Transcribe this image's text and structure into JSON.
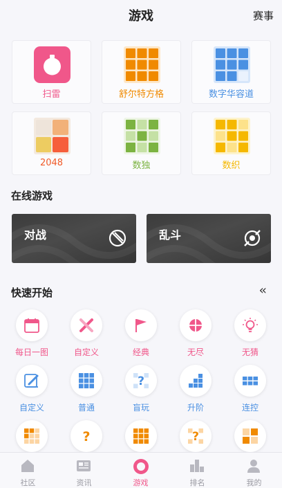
{
  "header": {
    "title": "游戏",
    "right_label": "赛事"
  },
  "games": [
    {
      "label": "扫雷",
      "color": "#f0578a",
      "icon": "mine-icon"
    },
    {
      "label": "舒尔特方格",
      "color": "#f08a00",
      "icon": "schulte-grid-icon"
    },
    {
      "label": "数字华容道",
      "color": "#4a90e2",
      "icon": "number-slide-icon"
    },
    {
      "label": "2048",
      "color": "#f05a28",
      "icon": "2048-icon"
    },
    {
      "label": "数独",
      "color": "#7cb342",
      "icon": "sudoku-icon"
    },
    {
      "label": "数织",
      "color": "#f5b800",
      "icon": "nonogram-icon"
    }
  ],
  "online": {
    "title": "在线游戏",
    "modes": [
      {
        "label": "对战",
        "icon": "battle-icon"
      },
      {
        "label": "乱斗",
        "icon": "brawl-icon"
      }
    ]
  },
  "quick": {
    "title": "快速开始",
    "collapse_icon": "double-chevron-left-icon",
    "rows": [
      [
        {
          "label": "每日一图",
          "icon": "calendar-icon",
          "color": "#f0578a"
        },
        {
          "label": "自定义",
          "icon": "tools-icon",
          "color": "#f0578a"
        },
        {
          "label": "经典",
          "icon": "flag-icon",
          "color": "#f0578a"
        },
        {
          "label": "无尽",
          "icon": "crosshair-icon",
          "color": "#f0578a"
        },
        {
          "label": "无猜",
          "icon": "bulb-icon",
          "color": "#f0578a"
        }
      ],
      [
        {
          "label": "自定义",
          "icon": "pen-icon",
          "color": "#4a90e2"
        },
        {
          "label": "普通",
          "icon": "grid-icon",
          "color": "#4a90e2"
        },
        {
          "label": "盲玩",
          "icon": "question-grid-icon",
          "color": "#4a90e2"
        },
        {
          "label": "升阶",
          "icon": "stairs-icon",
          "color": "#4a90e2"
        },
        {
          "label": "连控",
          "icon": "connected-grid-icon",
          "color": "#4a90e2"
        }
      ],
      [
        {
          "label": "",
          "icon": "small-grid-icon",
          "color": "#f08a00"
        },
        {
          "label": "",
          "icon": "question-icon",
          "color": "#f08a00"
        },
        {
          "label": "",
          "icon": "grid-icon",
          "color": "#f08a00"
        },
        {
          "label": "",
          "icon": "question-grid-icon",
          "color": "#f08a00"
        },
        {
          "label": "",
          "icon": "number-grid-icon",
          "color": "#f08a00"
        }
      ]
    ]
  },
  "tabs": [
    {
      "label": "社区",
      "icon": "home-icon",
      "active": false
    },
    {
      "label": "资讯",
      "icon": "news-icon",
      "active": false
    },
    {
      "label": "游戏",
      "icon": "game-icon",
      "active": true
    },
    {
      "label": "排名",
      "icon": "podium-icon",
      "active": false
    },
    {
      "label": "我的",
      "icon": "profile-icon",
      "active": false
    }
  ]
}
